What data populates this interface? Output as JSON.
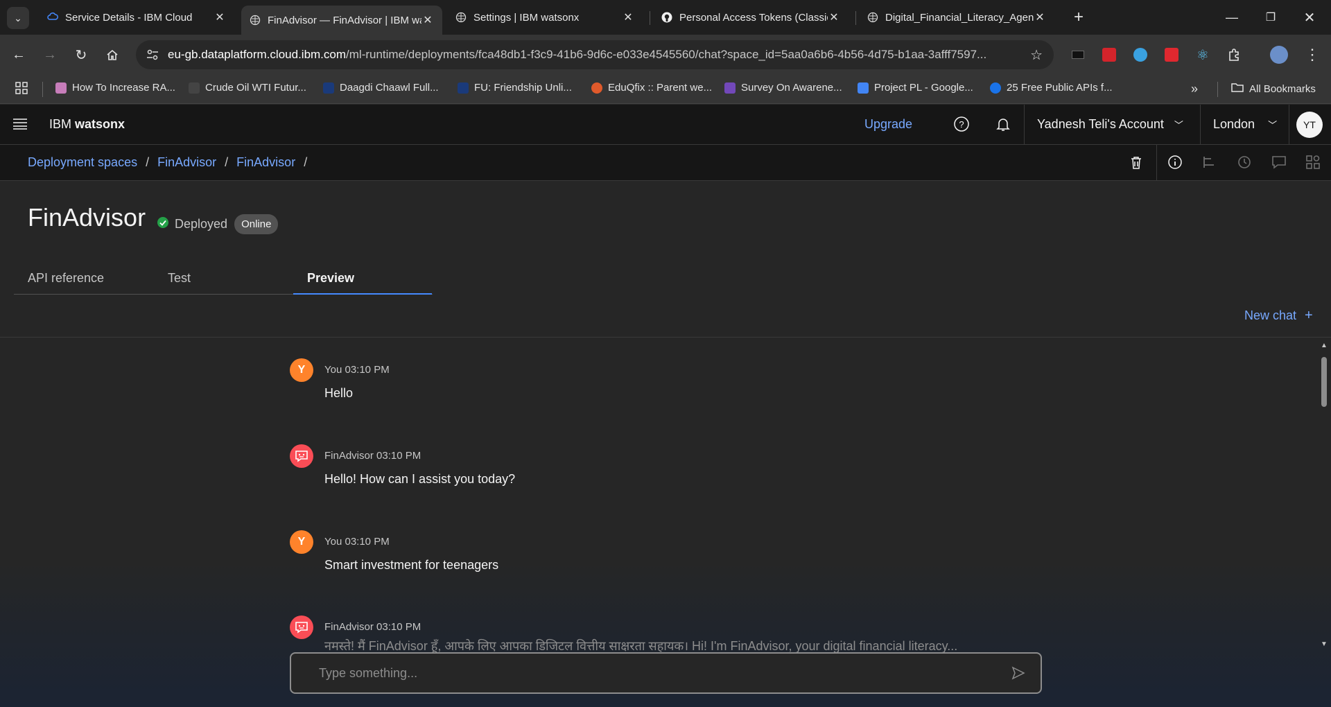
{
  "browser": {
    "tabs": [
      {
        "title": "Service Details - IBM Cloud",
        "active": false
      },
      {
        "title": "FinAdvisor — FinAdvisor | IBM watsonx",
        "active": true
      },
      {
        "title": "Settings | IBM watsonx",
        "active": false
      },
      {
        "title": "Personal Access Tokens (Classic)",
        "active": false
      },
      {
        "title": "Digital_Financial_Literacy_Agent",
        "active": false
      }
    ],
    "url_host": "eu-gb.dataplatform.cloud.ibm.com",
    "url_path": "/ml-runtime/deployments/fca48db1-f3c9-41b6-9d6c-e033e4545560/chat?space_id=5aa0a6b6-4b56-4d75-b1aa-3afff7597...",
    "bookmarks": [
      "How To Increase RA...",
      "Crude Oil WTI Futur...",
      "Daagdi Chaawl Full...",
      "FU: Friendship Unli...",
      "EduQfix :: Parent we...",
      "Survey On Awarene...",
      "Project PL - Google...",
      "25 Free Public APIs f..."
    ],
    "all_bookmarks": "All Bookmarks"
  },
  "header": {
    "brand_prefix": "IBM",
    "brand_name": "watsonx",
    "upgrade": "Upgrade",
    "account": "Yadnesh Teli's Account",
    "region": "London",
    "avatar_initials": "YT"
  },
  "breadcrumb": [
    "Deployment spaces",
    "FinAdvisor",
    "FinAdvisor"
  ],
  "page": {
    "title": "FinAdvisor",
    "status": "Deployed",
    "badge": "Online",
    "tabs": [
      "API reference",
      "Test",
      "Preview"
    ],
    "active_tab": "Preview",
    "new_chat": "New chat"
  },
  "chat": {
    "messages": [
      {
        "author": "You",
        "time": "03:10 PM",
        "text": "Hello",
        "avatar": "Y"
      },
      {
        "author": "FinAdvisor",
        "time": "03:10 PM",
        "text": "Hello! How can I assist you today?"
      },
      {
        "author": "You",
        "time": "03:10 PM",
        "text": "Smart investment for teenagers",
        "avatar": "Y"
      },
      {
        "author": "FinAdvisor",
        "time": "03:10 PM",
        "text": "नमस्ते! मैं FinAdvisor हूँ, आपके लिए आपका डिजिटल वित्तीय साक्षरता सहायक। Hi! I'm FinAdvisor, your digital financial literacy..."
      }
    ],
    "input_placeholder": "Type something..."
  },
  "colors": {
    "link": "#78a9ff",
    "deployed_green": "#24a148",
    "user_avatar": "#ff832b",
    "bot_avatar": "#fa4d56",
    "tab_underline": "#4589ff"
  }
}
